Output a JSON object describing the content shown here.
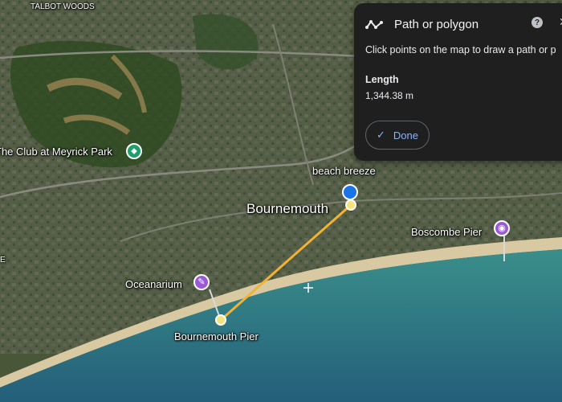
{
  "map": {
    "labels": {
      "talbot_woods": "TALBOT WOODS",
      "club": "The Club at Meyrick Park",
      "beach_breeze": "beach breeze",
      "bournemouth": "Bournemouth",
      "boscombe_pier": "Boscombe Pier",
      "oceanarium": "Oceanarium",
      "bournemouth_pier": "Bournemouth Pier",
      "edge_letter": "E"
    },
    "colors": {
      "path": "#f2b233",
      "poi_green": "#1e9e6a",
      "poi_purple": "#9b59d6",
      "selected_blue": "#1a73e8",
      "sea": "#2f7f86",
      "land": "#4a5638",
      "sand": "#d9c9a3"
    }
  },
  "panel": {
    "title": "Path or polygon",
    "help_glyph": "?",
    "instruction": "Click points on the map to draw a path or p",
    "length_label": "Length",
    "length_value": "1,344.38 m",
    "done_label": "Done",
    "close_fragment": "✕"
  }
}
